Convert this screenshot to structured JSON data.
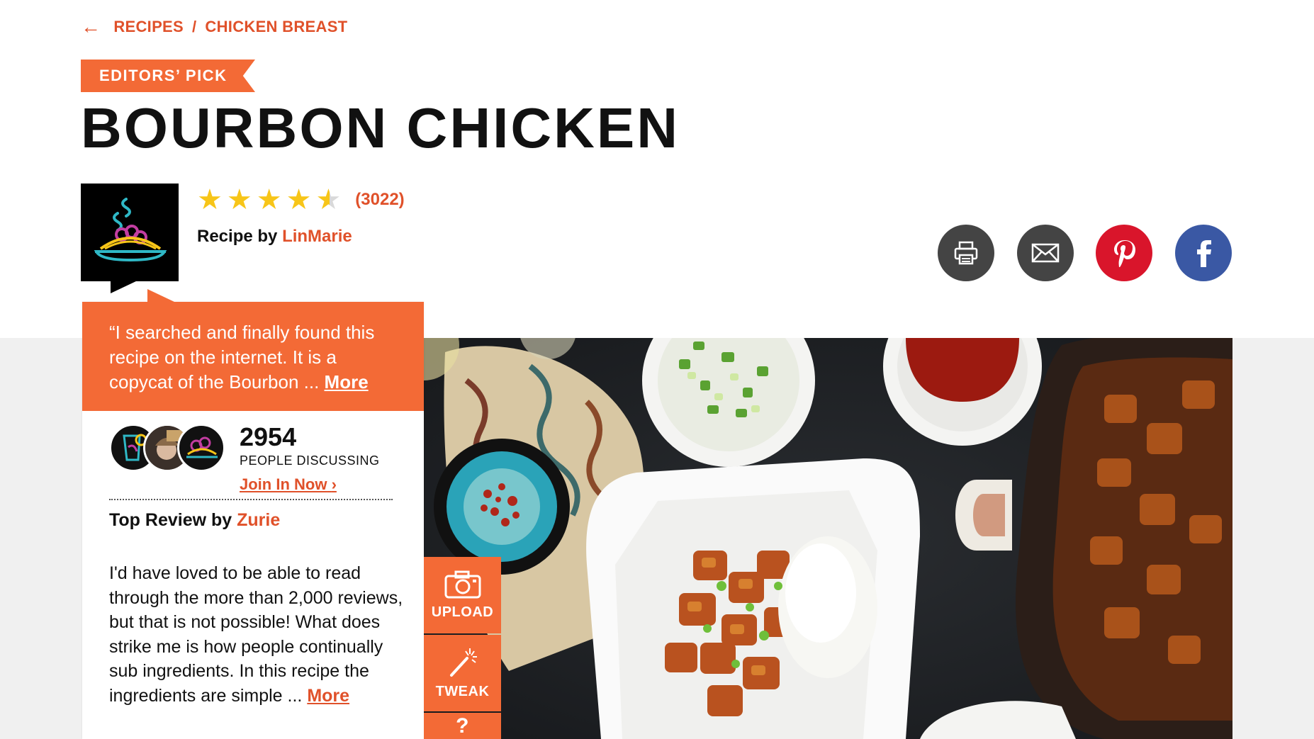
{
  "breadcrumb": {
    "back_icon": "arrow-left-icon",
    "items": [
      "RECIPES",
      "CHICKEN BREAST"
    ],
    "separator": "/"
  },
  "badge": "EDITORS’ PICK",
  "recipe": {
    "title": "BOURBON CHICKEN",
    "rating": 4.5,
    "rating_count": "(3022)",
    "byline_prefix": "Recipe by",
    "author": "LinMarie"
  },
  "share": [
    "print-icon",
    "email-icon",
    "pinterest-icon",
    "facebook-icon"
  ],
  "quote": {
    "text": "“I searched and finally found this recipe on the internet. It is a copycat of the Bourbon ...",
    "more": "More"
  },
  "discussion": {
    "count": "2954",
    "label": "PEOPLE DISCUSSING",
    "join": "Join In Now"
  },
  "top_review": {
    "prefix": "Top Review by",
    "author": "Zurie",
    "text": "I'd have loved to be able to read through the more than 2,000 reviews, but that is not possible! What does strike me is how people continually sub ingredients. In this recipe the ingredients are simple ...",
    "more": "More"
  },
  "tools": {
    "upload": "UPLOAD",
    "tweak": "TWEAK",
    "third": "?"
  },
  "colors": {
    "accent": "#f36a36",
    "link": "#e0512a",
    "star": "#f7c518",
    "pinterest": "#d9152b",
    "facebook": "#3a58a4"
  }
}
